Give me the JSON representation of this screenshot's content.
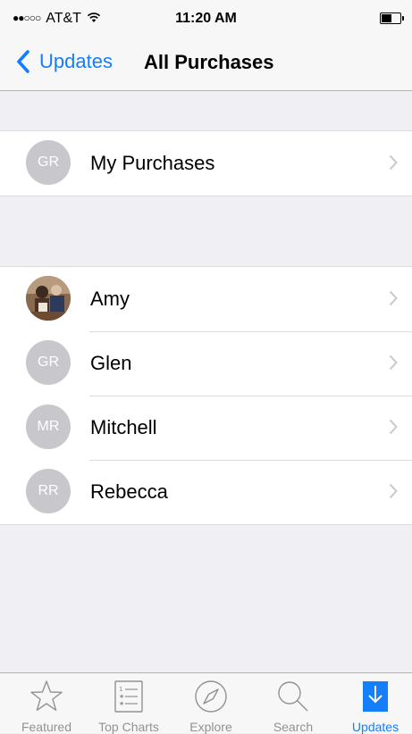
{
  "status_bar": {
    "signal_dots": "●●○○○",
    "carrier": "AT&T",
    "time": "11:20 AM",
    "wifi_icon": "wifi-icon",
    "battery_icon": "battery-icon",
    "battery_level": 0.55
  },
  "nav": {
    "back_label": "Updates",
    "title": "All Purchases"
  },
  "section_1": {
    "rows": [
      {
        "initials": "GR",
        "label": "My Purchases"
      }
    ]
  },
  "section_2": {
    "rows": [
      {
        "initials": "",
        "label": "Amy",
        "avatar": "photo"
      },
      {
        "initials": "GR",
        "label": "Glen"
      },
      {
        "initials": "MR",
        "label": "Mitchell"
      },
      {
        "initials": "RR",
        "label": "Rebecca"
      }
    ]
  },
  "tab_bar": {
    "tabs": [
      {
        "label": "Featured",
        "icon": "star-icon"
      },
      {
        "label": "Top Charts",
        "icon": "list-icon"
      },
      {
        "label": "Explore",
        "icon": "compass-icon"
      },
      {
        "label": "Search",
        "icon": "search-icon"
      },
      {
        "label": "Updates",
        "icon": "download-icon",
        "active": true
      }
    ]
  },
  "colors": {
    "accent": "#147efb",
    "avatar_gray": "#c7c7cc",
    "background": "#efeff4",
    "tab_inactive": "#929292"
  }
}
